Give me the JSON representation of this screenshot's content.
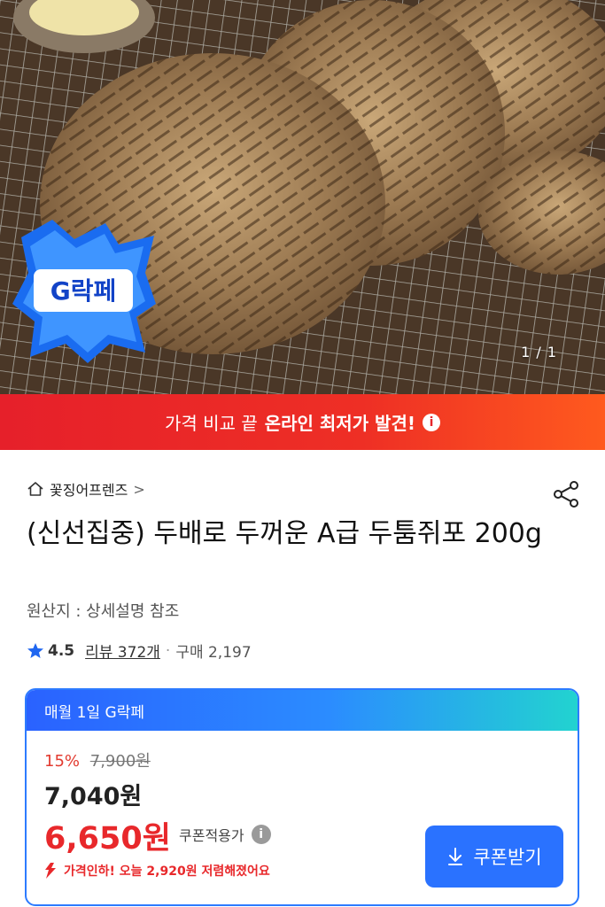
{
  "hero": {
    "badge_text": "G락페",
    "page_indicator": "1 / 1"
  },
  "promo": {
    "text_prefix": "가격 비교 끝",
    "text_bold": "온라인 최저가 발견!",
    "info_glyph": "i"
  },
  "product": {
    "seller": "꽃징어프렌즈",
    "seller_chevron": ">",
    "title": "(신선집중) 두배로 두꺼운 A급 두툼쥐포 200g",
    "origin": "원산지 : 상세설명 참조",
    "rating": "4.5",
    "reviews": "리뷰 372개",
    "separator": "·",
    "purchases": "구매 2,197"
  },
  "price_card": {
    "header": "매월 1일 G락페",
    "discount_rate": "15%",
    "original_price": "7,900원",
    "sale_price": "7,040원",
    "coupon_price": "6,650원",
    "coupon_label": "쿠폰적용가",
    "coupon_info_glyph": "i",
    "price_drop_note": "가격인하! 오늘 2,920원 저렴해졌어요",
    "coupon_button": "쿠폰받기"
  },
  "colors": {
    "promo_red": "#e6202a",
    "accent_blue": "#2a72ff",
    "price_red": "#e8282b"
  },
  "icons": [
    "home-icon",
    "share-icon",
    "star-icon",
    "info-icon",
    "arrow-down-icon",
    "download-icon"
  ]
}
